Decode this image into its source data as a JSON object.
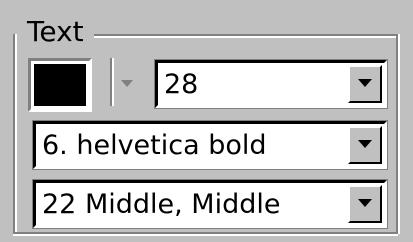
{
  "group": {
    "title": "Text"
  },
  "color_picker": {
    "color": "#000000"
  },
  "font_size": {
    "value": "28"
  },
  "font_family": {
    "value": "6. helvetica bold"
  },
  "justification": {
    "value": "22 Middle, Middle"
  }
}
